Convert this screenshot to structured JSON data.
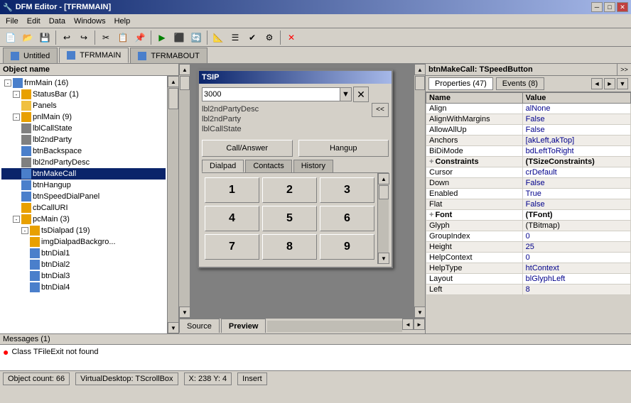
{
  "window": {
    "title": "DFM Editor - [TFRMMAIN]",
    "min_btn": "─",
    "max_btn": "□",
    "close_btn": "✕"
  },
  "menu": {
    "items": [
      "File",
      "Edit",
      "Data",
      "Windows",
      "Help"
    ]
  },
  "tabs": [
    {
      "label": "Untitled",
      "active": false
    },
    {
      "label": "TFRMMAIN",
      "active": true
    },
    {
      "label": "TFRMABOUT",
      "active": false
    }
  ],
  "object_tree": {
    "header": "Object name",
    "items": [
      {
        "indent": 0,
        "expand": "-",
        "icon": "form",
        "label": "frmMain (16)",
        "level": 0
      },
      {
        "indent": 1,
        "expand": "-",
        "icon": "component",
        "label": "StatusBar (1)",
        "level": 1
      },
      {
        "indent": 2,
        "expand": null,
        "icon": "folder",
        "label": "Panels",
        "level": 2
      },
      {
        "indent": 1,
        "expand": "-",
        "icon": "component",
        "label": "pnlMain (9)",
        "level": 1
      },
      {
        "indent": 2,
        "expand": null,
        "icon": "label",
        "label": "lblCallState",
        "level": 2
      },
      {
        "indent": 2,
        "expand": null,
        "icon": "label",
        "label": "lbl2ndParty",
        "level": 2
      },
      {
        "indent": 2,
        "expand": null,
        "icon": "btn",
        "label": "btnBackspace",
        "level": 2
      },
      {
        "indent": 2,
        "expand": null,
        "icon": "label",
        "label": "lbl2ndPartyDesc",
        "level": 2
      },
      {
        "indent": 2,
        "expand": null,
        "icon": "btn",
        "label": "btnMakeCall",
        "level": 2,
        "selected": true
      },
      {
        "indent": 2,
        "expand": null,
        "icon": "btn",
        "label": "btnHangup",
        "level": 2
      },
      {
        "indent": 2,
        "expand": null,
        "icon": "btn",
        "label": "btnSpeedDialPanel",
        "level": 2
      },
      {
        "indent": 2,
        "expand": null,
        "icon": "component",
        "label": "cbCallURI",
        "level": 2
      },
      {
        "indent": 1,
        "expand": "-",
        "icon": "component",
        "label": "pcMain (3)",
        "level": 1
      },
      {
        "indent": 2,
        "expand": "-",
        "icon": "component",
        "label": "tsDialpad (19)",
        "level": 2
      },
      {
        "indent": 3,
        "expand": null,
        "icon": "component",
        "label": "imgDialpadBackgro...",
        "level": 3
      },
      {
        "indent": 3,
        "expand": null,
        "icon": "btn",
        "label": "btnDial1",
        "level": 3
      },
      {
        "indent": 3,
        "expand": null,
        "icon": "btn",
        "label": "btnDial2",
        "level": 3
      },
      {
        "indent": 3,
        "expand": null,
        "icon": "btn",
        "label": "btnDial3",
        "level": 3
      },
      {
        "indent": 3,
        "expand": null,
        "icon": "btn",
        "label": "btnDial4",
        "level": 3
      }
    ]
  },
  "tsip": {
    "title": "TSIP",
    "input_value": "3000",
    "lbl1": "lbl2ndPartyDesc",
    "lbl2": "lbl2ndParty",
    "lbl3": "lblCallState",
    "call_btn": "Call/Answer",
    "hangup_btn": "Hangup",
    "tabs": [
      "Dialpad",
      "Contacts",
      "History"
    ],
    "active_tab": "Dialpad",
    "dial_buttons": [
      "1",
      "2",
      "3",
      "4",
      "5",
      "6",
      "7",
      "8",
      "9"
    ]
  },
  "source_preview": {
    "source_label": "Source",
    "preview_label": "Preview",
    "active": "Preview"
  },
  "properties_panel": {
    "title": "btnMakeCall: TSpeedButton",
    "prop_tab": "Properties (47)",
    "events_tab": "Events (8)",
    "columns": [
      "Name",
      "Value"
    ],
    "rows": [
      {
        "name": "Align",
        "value": "alNone",
        "type": "val"
      },
      {
        "name": "AlignWithMargins",
        "value": "False",
        "type": "val"
      },
      {
        "name": "AllowAllUp",
        "value": "False",
        "type": "val"
      },
      {
        "name": "Anchors",
        "value": "[akLeft,akTop]",
        "type": "val"
      },
      {
        "name": "BiDiMode",
        "value": "bdLeftToRight",
        "type": "val"
      },
      {
        "name": "+ Constraints",
        "value": "(TSizeConstraints)",
        "type": "section"
      },
      {
        "name": "Cursor",
        "value": "crDefault",
        "type": "val"
      },
      {
        "name": "Down",
        "value": "False",
        "type": "val"
      },
      {
        "name": "Enabled",
        "value": "True",
        "type": "val"
      },
      {
        "name": "Flat",
        "value": "False",
        "type": "val"
      },
      {
        "name": "+ Font",
        "value": "(TFont)",
        "type": "section"
      },
      {
        "name": "Glyph",
        "value": "(TBitmap)",
        "type": "val"
      },
      {
        "name": "GroupIndex",
        "value": "0",
        "type": "val"
      },
      {
        "name": "Height",
        "value": "25",
        "type": "val"
      },
      {
        "name": "HelpContext",
        "value": "0",
        "type": "val"
      },
      {
        "name": "HelpType",
        "value": "htContext",
        "type": "val"
      },
      {
        "name": "Layout",
        "value": "blGlyphLeft",
        "type": "val"
      },
      {
        "name": "Left",
        "value": "8",
        "type": "val"
      }
    ]
  },
  "messages": {
    "header": "Messages (1)",
    "items": [
      {
        "type": "error",
        "text": "Class TFileExit not found"
      }
    ]
  },
  "status_bar": {
    "object_count": "Object count: 66",
    "virtual_desktop": "VirtualDesktop: TScrollBox",
    "coordinates": "X: 238  Y: 4",
    "mode": "Insert"
  }
}
